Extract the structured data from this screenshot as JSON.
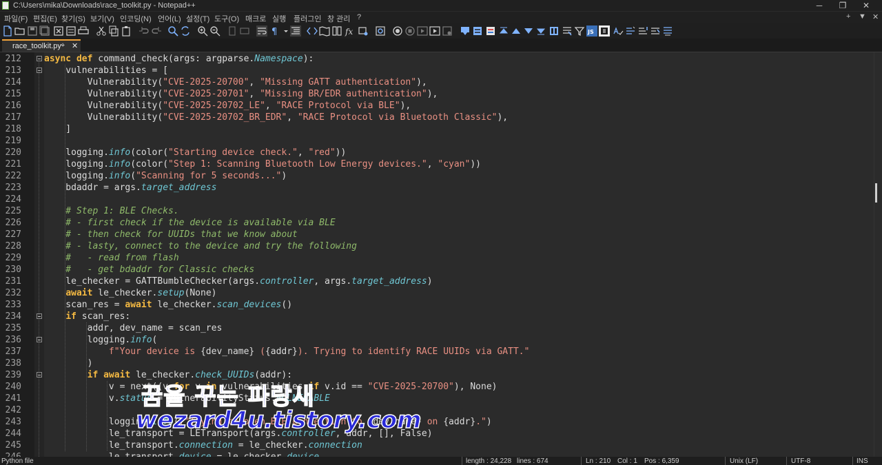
{
  "window": {
    "title": "C:\\Users\\mika\\Downloads\\race_toolkit.py - Notepad++",
    "controls": {
      "minimize": "─",
      "maximize": "❐",
      "close": "✕"
    }
  },
  "menu": {
    "items": [
      "파일(F)",
      "편집(E)",
      "찾기(S)",
      "보기(V)",
      "인코딩(N)",
      "언어(L)",
      "설정(T)",
      "도구(O)",
      "매크로",
      "실행",
      "플러그인",
      "창 관리",
      "?"
    ],
    "right_controls": {
      "add": "+",
      "dropdown": "▼",
      "close": "✕"
    }
  },
  "tab": {
    "label": "race_toolkit.py",
    "pin": "⌖",
    "close": "✕"
  },
  "editor": {
    "lines": [
      {
        "n": "212",
        "fold": true,
        "tokens": [
          {
            "t": "async def ",
            "c": "kw"
          },
          {
            "t": "command_check(args: argparse."
          },
          {
            "t": "Namespace",
            "c": "attr"
          },
          {
            "t": "):"
          }
        ]
      },
      {
        "n": "213",
        "fold": true,
        "tokens": [
          {
            "t": "    vulnerabilities = ["
          }
        ]
      },
      {
        "n": "214",
        "tokens": [
          {
            "t": "        Vulnerability("
          },
          {
            "t": "\"CVE-2025-20700\"",
            "c": "str"
          },
          {
            "t": ", "
          },
          {
            "t": "\"Missing GATT authentication\"",
            "c": "str"
          },
          {
            "t": "),"
          }
        ]
      },
      {
        "n": "215",
        "tokens": [
          {
            "t": "        Vulnerability("
          },
          {
            "t": "\"CVE-2025-20701\"",
            "c": "str"
          },
          {
            "t": ", "
          },
          {
            "t": "\"Missing BR/EDR authentication\"",
            "c": "str"
          },
          {
            "t": "),"
          }
        ]
      },
      {
        "n": "216",
        "tokens": [
          {
            "t": "        Vulnerability("
          },
          {
            "t": "\"CVE-2025-20702_LE\"",
            "c": "str"
          },
          {
            "t": ", "
          },
          {
            "t": "\"RACE Protocol via BLE\"",
            "c": "str"
          },
          {
            "t": "),"
          }
        ]
      },
      {
        "n": "217",
        "tokens": [
          {
            "t": "        Vulnerability("
          },
          {
            "t": "\"CVE-2025-20702_BR_EDR\"",
            "c": "str"
          },
          {
            "t": ", "
          },
          {
            "t": "\"RACE Protocol via Bluetooth Classic\"",
            "c": "str"
          },
          {
            "t": "),"
          }
        ]
      },
      {
        "n": "218",
        "tokens": [
          {
            "t": "    ]"
          }
        ]
      },
      {
        "n": "219",
        "tokens": [
          {
            "t": ""
          }
        ]
      },
      {
        "n": "220",
        "tokens": [
          {
            "t": "    logging."
          },
          {
            "t": "info",
            "c": "attr"
          },
          {
            "t": "(color("
          },
          {
            "t": "\"Starting device check.\"",
            "c": "str"
          },
          {
            "t": ", "
          },
          {
            "t": "\"red\"",
            "c": "str"
          },
          {
            "t": "))"
          }
        ]
      },
      {
        "n": "221",
        "tokens": [
          {
            "t": "    logging."
          },
          {
            "t": "info",
            "c": "attr"
          },
          {
            "t": "(color("
          },
          {
            "t": "\"Step 1: Scanning Bluetooth Low Energy devices.\"",
            "c": "str"
          },
          {
            "t": ", "
          },
          {
            "t": "\"cyan\"",
            "c": "str"
          },
          {
            "t": "))"
          }
        ]
      },
      {
        "n": "222",
        "tokens": [
          {
            "t": "    logging."
          },
          {
            "t": "info",
            "c": "attr"
          },
          {
            "t": "("
          },
          {
            "t": "\"Scanning for 5 seconds...\"",
            "c": "str"
          },
          {
            "t": ")"
          }
        ]
      },
      {
        "n": "223",
        "tokens": [
          {
            "t": "    bdaddr = args."
          },
          {
            "t": "target_address",
            "c": "attr"
          }
        ]
      },
      {
        "n": "224",
        "tokens": [
          {
            "t": ""
          }
        ]
      },
      {
        "n": "225",
        "tokens": [
          {
            "t": "    # Step 1: BLE Checks.",
            "c": "com"
          }
        ]
      },
      {
        "n": "226",
        "tokens": [
          {
            "t": "    # - first check if the device is available via BLE",
            "c": "com"
          }
        ]
      },
      {
        "n": "227",
        "tokens": [
          {
            "t": "    # - then check for UUIDs that we know about",
            "c": "com"
          }
        ]
      },
      {
        "n": "228",
        "tokens": [
          {
            "t": "    # - lasty, connect to the device and try the following",
            "c": "com"
          }
        ]
      },
      {
        "n": "229",
        "tokens": [
          {
            "t": "    #   - read from flash",
            "c": "com"
          }
        ]
      },
      {
        "n": "230",
        "tokens": [
          {
            "t": "    #   - get bdaddr for Classic checks",
            "c": "com"
          }
        ]
      },
      {
        "n": "231",
        "tokens": [
          {
            "t": "    le_checker = GATTBumbleChecker(args."
          },
          {
            "t": "controller",
            "c": "attr"
          },
          {
            "t": ", args."
          },
          {
            "t": "target_address",
            "c": "attr"
          },
          {
            "t": ")"
          }
        ]
      },
      {
        "n": "232",
        "tokens": [
          {
            "t": "    "
          },
          {
            "t": "await ",
            "c": "kw"
          },
          {
            "t": "le_checker."
          },
          {
            "t": "setup",
            "c": "attr"
          },
          {
            "t": "(None)"
          }
        ]
      },
      {
        "n": "233",
        "tokens": [
          {
            "t": "    scan_res = "
          },
          {
            "t": "await ",
            "c": "kw"
          },
          {
            "t": "le_checker."
          },
          {
            "t": "scan_devices",
            "c": "attr"
          },
          {
            "t": "()"
          }
        ]
      },
      {
        "n": "234",
        "fold": true,
        "tokens": [
          {
            "t": "    "
          },
          {
            "t": "if ",
            "c": "kw"
          },
          {
            "t": "scan_res:"
          }
        ]
      },
      {
        "n": "235",
        "tokens": [
          {
            "t": "        addr, dev_name = scan_res"
          }
        ]
      },
      {
        "n": "236",
        "fold": true,
        "tokens": [
          {
            "t": "        logging."
          },
          {
            "t": "info",
            "c": "attr"
          },
          {
            "t": "("
          }
        ]
      },
      {
        "n": "237",
        "tokens": [
          {
            "t": "            "
          },
          {
            "t": "f\"Your device is ",
            "c": "str"
          },
          {
            "t": "{dev_name}"
          },
          {
            "t": " (",
            "c": "str"
          },
          {
            "t": "{addr}"
          },
          {
            "t": "). Trying to identify RACE UUIDs via GATT.\"",
            "c": "str"
          }
        ]
      },
      {
        "n": "238",
        "tokens": [
          {
            "t": "        )"
          }
        ]
      },
      {
        "n": "239",
        "fold": true,
        "tokens": [
          {
            "t": "        "
          },
          {
            "t": "if await ",
            "c": "kw"
          },
          {
            "t": "le_checker."
          },
          {
            "t": "check_UUIDs",
            "c": "attr"
          },
          {
            "t": "(addr):"
          }
        ]
      },
      {
        "n": "240",
        "tokens": [
          {
            "t": "            v = next((v "
          },
          {
            "t": "for ",
            "c": "kw"
          },
          {
            "t": "v "
          },
          {
            "t": "in ",
            "c": "kw"
          },
          {
            "t": "vulnerabilities "
          },
          {
            "t": "if ",
            "c": "kw"
          },
          {
            "t": "v.id == "
          },
          {
            "t": "\"CVE-2025-20700\"",
            "c": "str"
          },
          {
            "t": "), None)"
          }
        ]
      },
      {
        "n": "241",
        "tokens": [
          {
            "t": "            v."
          },
          {
            "t": "status",
            "c": "attr"
          },
          {
            "t": " = VulnerabilityStatus."
          },
          {
            "t": "VULNERABLE",
            "c": "attr"
          }
        ]
      },
      {
        "n": "242",
        "tokens": [
          {
            "t": ""
          }
        ]
      },
      {
        "n": "243",
        "tokens": [
          {
            "t": "            logging."
          },
          {
            "t": "info",
            "c": "attr"
          },
          {
            "t": "("
          },
          {
            "t": "f\"Trying to open BLE connection to ",
            "c": "str"
          },
          {
            "t": "{dev_name}"
          },
          {
            "t": " on ",
            "c": "str"
          },
          {
            "t": "{addr}"
          },
          {
            "t": ".\"",
            "c": "str"
          },
          {
            "t": ")"
          }
        ]
      },
      {
        "n": "244",
        "tokens": [
          {
            "t": "            le_transport = LETransport(args."
          },
          {
            "t": "controller",
            "c": "attr"
          },
          {
            "t": ", addr, [], False)"
          }
        ]
      },
      {
        "n": "245",
        "tokens": [
          {
            "t": "            le_transport."
          },
          {
            "t": "connection",
            "c": "attr"
          },
          {
            "t": " = le_checker."
          },
          {
            "t": "connection",
            "c": "attr"
          }
        ]
      },
      {
        "n": "246",
        "tokens": [
          {
            "t": "            le_transport."
          },
          {
            "t": "device",
            "c": "attr"
          },
          {
            "t": " = le_checker."
          },
          {
            "t": "device",
            "c": "attr"
          }
        ]
      }
    ]
  },
  "watermark": {
    "line1": "꿈을 꾸는 파랑새",
    "line2": "wezard4u.tistory.com"
  },
  "status": {
    "file_type": "Python file",
    "length": "length : 24,228",
    "lines": "lines : 674",
    "ln": "Ln : 210",
    "col": "Col : 1",
    "pos": "Pos : 6,359",
    "eol": "Unix (LF)",
    "encoding": "UTF-8",
    "mode": "INS"
  },
  "colors": {
    "keyword": "#f4b942",
    "string": "#e99083",
    "comment": "#8fba6a",
    "attribute": "#6fc7d4",
    "tab_accent": "#f3a43a"
  }
}
